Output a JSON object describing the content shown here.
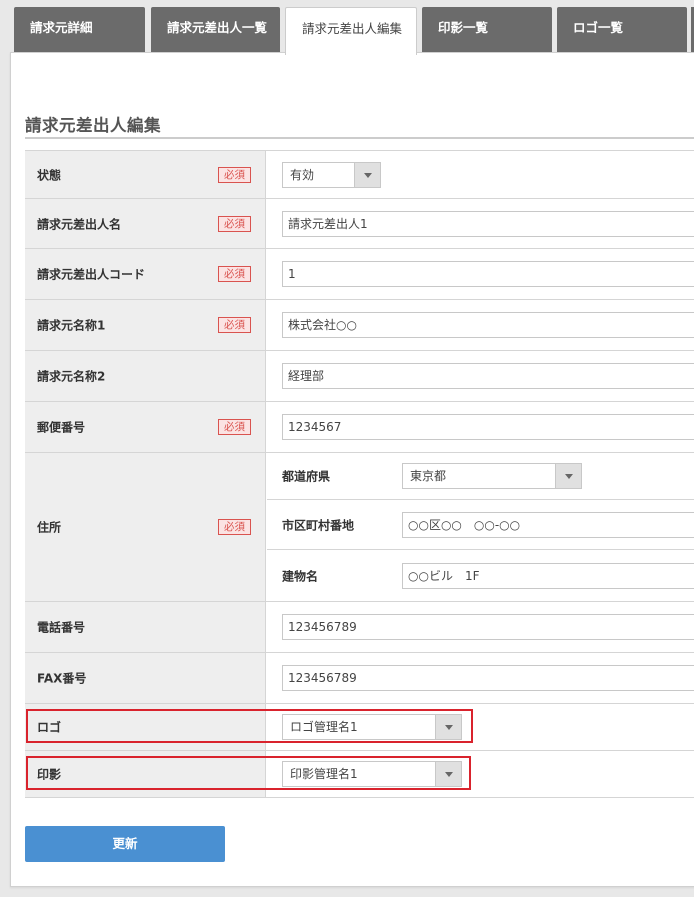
{
  "tabs": [
    {
      "label": "請求元詳細"
    },
    {
      "label": "請求元差出人一覧"
    },
    {
      "label": "請求元差出人編集"
    },
    {
      "label": "印影一覧"
    },
    {
      "label": "ロゴ一覧"
    }
  ],
  "page_title": "請求元差出人編集",
  "required_label": "必須",
  "fields": {
    "status": {
      "label": "状態",
      "value": "有効"
    },
    "sender_name": {
      "label": "請求元差出人名",
      "value": "請求元差出人1"
    },
    "sender_code": {
      "label": "請求元差出人コード",
      "value": "1"
    },
    "name1": {
      "label": "請求元名称1",
      "value": "株式会社○○"
    },
    "name2": {
      "label": "請求元名称2",
      "value": "経理部"
    },
    "postal": {
      "label": "郵便番号",
      "value": "1234567"
    },
    "address": {
      "label": "住所",
      "prefecture": {
        "label": "都道府県",
        "value": "東京都"
      },
      "city": {
        "label": "市区町村番地",
        "value": "○○区○○　○○-○○"
      },
      "building": {
        "label": "建物名",
        "value": "○○ビル　1F"
      }
    },
    "phone": {
      "label": "電話番号",
      "value": "123456789"
    },
    "fax": {
      "label": "FAX番号",
      "value": "123456789"
    },
    "logo": {
      "label": "ロゴ",
      "value": "ロゴ管理名1"
    },
    "seal": {
      "label": "印影",
      "value": "印影管理名1"
    }
  },
  "submit_label": "更新",
  "colors": {
    "tab_bg": "#6b6b6b",
    "required": "#d9534f",
    "highlight": "#d9232d",
    "button": "#4a90d2"
  }
}
